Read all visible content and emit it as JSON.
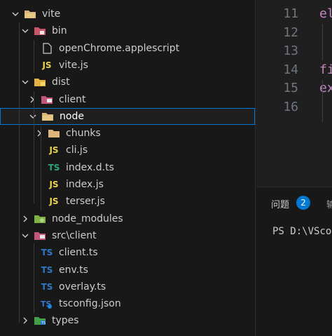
{
  "explorer": {
    "items": [
      {
        "label": "vite",
        "depth": 0,
        "kind": "folder",
        "expanded": true,
        "icon": "folder-open-icon"
      },
      {
        "label": "bin",
        "depth": 1,
        "kind": "folder",
        "expanded": true,
        "icon": "folder-bin-icon"
      },
      {
        "label": "openChrome.applescript",
        "depth": 2,
        "kind": "file",
        "icon": "file-icon",
        "badge": ""
      },
      {
        "label": "vite.js",
        "depth": 2,
        "kind": "file",
        "icon": "js-file-icon",
        "badge": "JS"
      },
      {
        "label": "dist",
        "depth": 1,
        "kind": "folder",
        "expanded": true,
        "icon": "folder-dist-icon"
      },
      {
        "label": "client",
        "depth": 2,
        "kind": "folder",
        "expanded": false,
        "icon": "folder-client-icon"
      },
      {
        "label": "node",
        "depth": 2,
        "kind": "folder",
        "expanded": true,
        "icon": "folder-node-icon",
        "selected": true
      },
      {
        "label": "chunks",
        "depth": 3,
        "kind": "folder",
        "expanded": false,
        "icon": "folder-icon"
      },
      {
        "label": "cli.js",
        "depth": 3,
        "kind": "file",
        "icon": "js-file-icon",
        "badge": "JS"
      },
      {
        "label": "index.d.ts",
        "depth": 3,
        "kind": "file",
        "icon": "ts-definition-icon",
        "badge": "TS"
      },
      {
        "label": "index.js",
        "depth": 3,
        "kind": "file",
        "icon": "js-file-icon",
        "badge": "JS"
      },
      {
        "label": "terser.js",
        "depth": 3,
        "kind": "file",
        "icon": "js-file-icon",
        "badge": "JS"
      },
      {
        "label": "node_modules",
        "depth": 1,
        "kind": "folder",
        "expanded": false,
        "icon": "folder-node-modules-icon"
      },
      {
        "label": "src\\client",
        "depth": 1,
        "kind": "folder",
        "expanded": true,
        "icon": "folder-src-icon"
      },
      {
        "label": "client.ts",
        "depth": 2,
        "kind": "file",
        "icon": "ts-file-icon",
        "badge": "TS"
      },
      {
        "label": "env.ts",
        "depth": 2,
        "kind": "file",
        "icon": "ts-file-icon",
        "badge": "TS"
      },
      {
        "label": "overlay.ts",
        "depth": 2,
        "kind": "file",
        "icon": "ts-file-icon",
        "badge": "TS"
      },
      {
        "label": "tsconfig.json",
        "depth": 2,
        "kind": "file",
        "icon": "tsconfig-icon",
        "badge": "TS"
      },
      {
        "label": "types",
        "depth": 1,
        "kind": "folder",
        "expanded": false,
        "icon": "folder-types-icon"
      }
    ]
  },
  "editor": {
    "lines": [
      {
        "num": "11",
        "text": "el"
      },
      {
        "num": "12",
        "text": ""
      },
      {
        "num": "13",
        "text": ""
      },
      {
        "num": "14",
        "text": "fi"
      },
      {
        "num": "15",
        "text": "ex"
      },
      {
        "num": "16",
        "text": ""
      }
    ],
    "colors": {
      "keyword": "#c586c0",
      "func": "#dcdcaa"
    }
  },
  "panel": {
    "tab_problems": "问题",
    "problems_count": "2",
    "tab_next": "输",
    "terminal_line": "PS D:\\VScod"
  }
}
